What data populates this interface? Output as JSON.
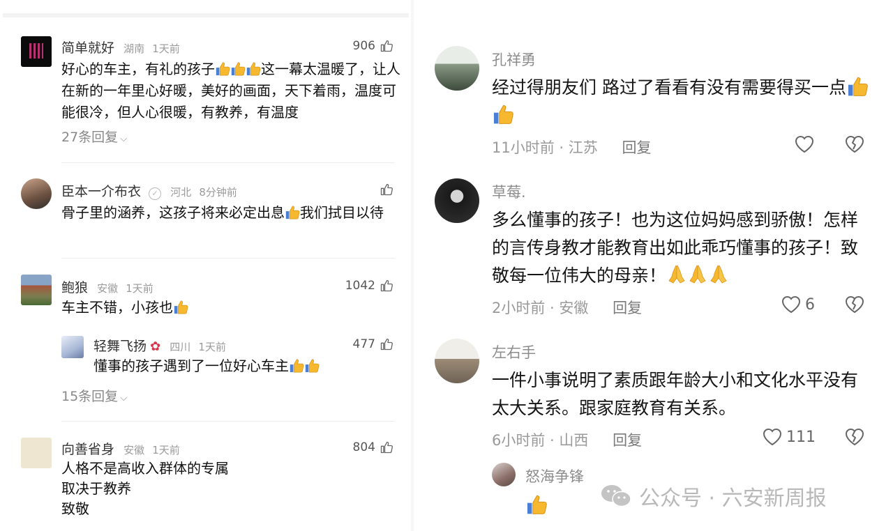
{
  "left": {
    "comments": [
      {
        "name": "简单就好",
        "region": "湖南",
        "time": "1天前",
        "likes": "906",
        "text_a": "好心的车主，有礼的孩子",
        "text_b": "这一幕太温暖了，让人在新的一年里心好暖，美好的画面，天下着雨，温度可能很冷，但人心很暖，有教养，有温度",
        "more": "27条回复"
      },
      {
        "name": "臣本一介布衣",
        "region": "河北",
        "time": "8分钟前",
        "likes": "",
        "text_a": "骨子里的涵养，这孩子将来必定出息",
        "text_b": "我们拭目以待"
      },
      {
        "name": "鲍狼",
        "region": "安徽",
        "time": "1天前",
        "likes": "1042",
        "text_a": "车主不错，小孩也",
        "reply": {
          "name": "轻舞飞扬",
          "region": "四川",
          "time": "1天前",
          "likes": "477",
          "text": "懂事的孩子遇到了一位好心车主"
        },
        "more": "15条回复"
      },
      {
        "name": "向善省身",
        "region": "安徽",
        "time": "1天前",
        "likes": "804",
        "line1": "人格不是高收入群体的专属",
        "line2": "取决于教养",
        "line3": "致敬"
      }
    ]
  },
  "right": {
    "comments": [
      {
        "name": "孔祥勇",
        "text": "经过得朋友们 路过了看看有没有需要得买一点",
        "time": "11小时前",
        "region": "江苏",
        "reply": "回复",
        "likes": ""
      },
      {
        "name": "草莓.",
        "text": "多么懂事的孩子！也为这位妈妈感到骄傲！怎样的言传身教才能教育出如此乖巧懂事的孩子！致敬每一位伟大的母亲！",
        "time": "2小时前",
        "region": "安徽",
        "reply": "回复",
        "likes": "6"
      },
      {
        "name": "左右手",
        "text": "一件小事说明了素质跟年龄大小和文化水平没有太大关系。跟家庭教育有关系。",
        "time": "6小时前",
        "region": "山西",
        "reply": "回复",
        "likes": "111"
      },
      {
        "name": "怒海争锋"
      }
    ],
    "watermark": "公众号 · 六安新周报"
  },
  "colors": {
    "accent_yellow": "#f5b82e",
    "text_gray": "#9a9a9a"
  },
  "icons": [
    "thumbs-up-outline-icon",
    "thumbs-up-emoji-icon",
    "heart-outline-icon",
    "broken-heart-icon",
    "pray-emoji-icon",
    "chevron-down-icon",
    "wechat-icon",
    "verified-icon",
    "flower-emoji-icon"
  ]
}
